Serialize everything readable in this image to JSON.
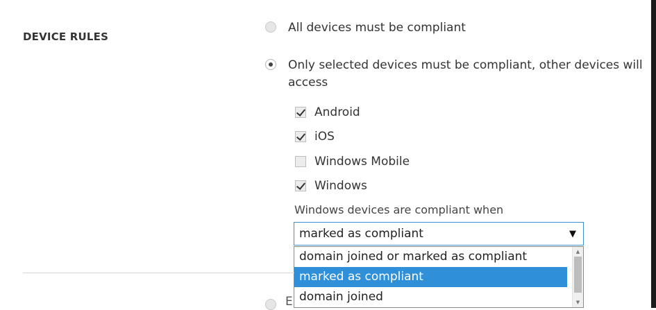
{
  "section": {
    "title": "DEVICE RULES"
  },
  "rules": {
    "option_all": "All devices must be compliant",
    "option_selected_line1": "Only selected devices must be compliant, other devices will",
    "option_selected_line2": "access",
    "selected_option": "selected"
  },
  "platforms": [
    {
      "label": "Android",
      "checked": true
    },
    {
      "label": "iOS",
      "checked": true
    },
    {
      "label": "Windows Mobile",
      "checked": false
    },
    {
      "label": "Windows",
      "checked": true
    }
  ],
  "windows_compliance": {
    "label": "Windows devices are compliant when",
    "selected_value": "marked as compliant",
    "options": [
      "domain joined or marked as compliant",
      "marked as compliant",
      "domain joined"
    ],
    "highlighted_index": 1
  },
  "next_section": {
    "partial_text": "E"
  },
  "colors": {
    "accent": "#2f8fd8",
    "focus_border": "#3d8fd6"
  }
}
